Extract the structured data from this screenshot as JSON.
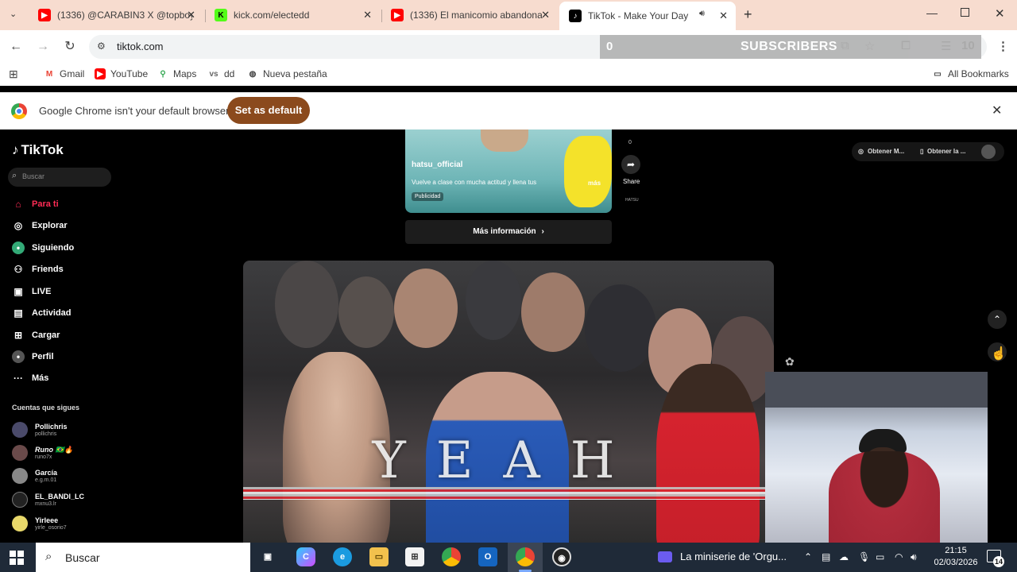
{
  "browser": {
    "tabs": [
      {
        "label": "(1336) @CARABIN3 X @topboy",
        "favicon": "youtube",
        "color": "#ff0000"
      },
      {
        "label": "kick.com/electedd",
        "favicon": "kick",
        "color": "#53fc18"
      },
      {
        "label": "(1336) El manicomio abandona",
        "favicon": "youtube",
        "color": "#ff0000"
      },
      {
        "label": "TikTok - Make Your Day",
        "favicon": "tiktok",
        "color": "#000000"
      }
    ],
    "url": "tiktok.com",
    "bookmarks": [
      {
        "label": "Gmail",
        "icon": "gmail-icon"
      },
      {
        "label": "YouTube",
        "icon": "youtube-icon"
      },
      {
        "label": "Maps",
        "icon": "maps-icon"
      },
      {
        "label": "dd",
        "icon": "dd-icon"
      },
      {
        "label": "Nueva pestaña",
        "icon": "globe-icon"
      }
    ],
    "all_bookmarks": "All Bookmarks",
    "extension_badge": "10",
    "infobar": {
      "text": "Google Chrome isn't your default browser",
      "button": "Set as default"
    }
  },
  "overlay": {
    "subscriber_count": "0",
    "subscriber_label": "SUBSCRIBERS"
  },
  "tiktok": {
    "logo": "TikTok",
    "search_placeholder": "Buscar",
    "nav": [
      {
        "label": "Para ti",
        "icon": "home-icon",
        "active": true
      },
      {
        "label": "Explorar",
        "icon": "compass-icon"
      },
      {
        "label": "Siguiendo",
        "icon": "following-icon"
      },
      {
        "label": "Friends",
        "icon": "friends-icon"
      },
      {
        "label": "LIVE",
        "icon": "live-icon"
      },
      {
        "label": "Actividad",
        "icon": "activity-icon"
      },
      {
        "label": "Cargar",
        "icon": "upload-icon"
      },
      {
        "label": "Perfil",
        "icon": "profile-icon"
      },
      {
        "label": "Más",
        "icon": "more-icon"
      }
    ],
    "following_title": "Cuentas que sigues",
    "accounts": [
      {
        "name": "Pollichris",
        "user": "pollichris"
      },
      {
        "name": "Runo 🇧🇷🔥",
        "user": "runo7x"
      },
      {
        "name": "García",
        "user": "e.g.m.01"
      },
      {
        "name": "EL_BANDI_LC",
        "user": "mxnu3.lr"
      },
      {
        "name": "Yirleee",
        "user": "yirle_osorio7"
      }
    ],
    "ad": {
      "handle": "hatsu_official",
      "description": "Vuelve a clase con mucha actitud y llena tus",
      "more": "más",
      "badge": "Publicidad",
      "share": "Share",
      "count": "0",
      "mini_label": "HATSU",
      "more_info": "Más información"
    },
    "get_app": [
      "Obtener M...",
      "Obtener la ..."
    ],
    "video_caption": "YEAH"
  },
  "taskbar": {
    "search_placeholder": "Buscar",
    "now_playing": "La miniserie de 'Orgu...",
    "time": "21:15",
    "date": "02/03/2026",
    "notifications": "14"
  }
}
